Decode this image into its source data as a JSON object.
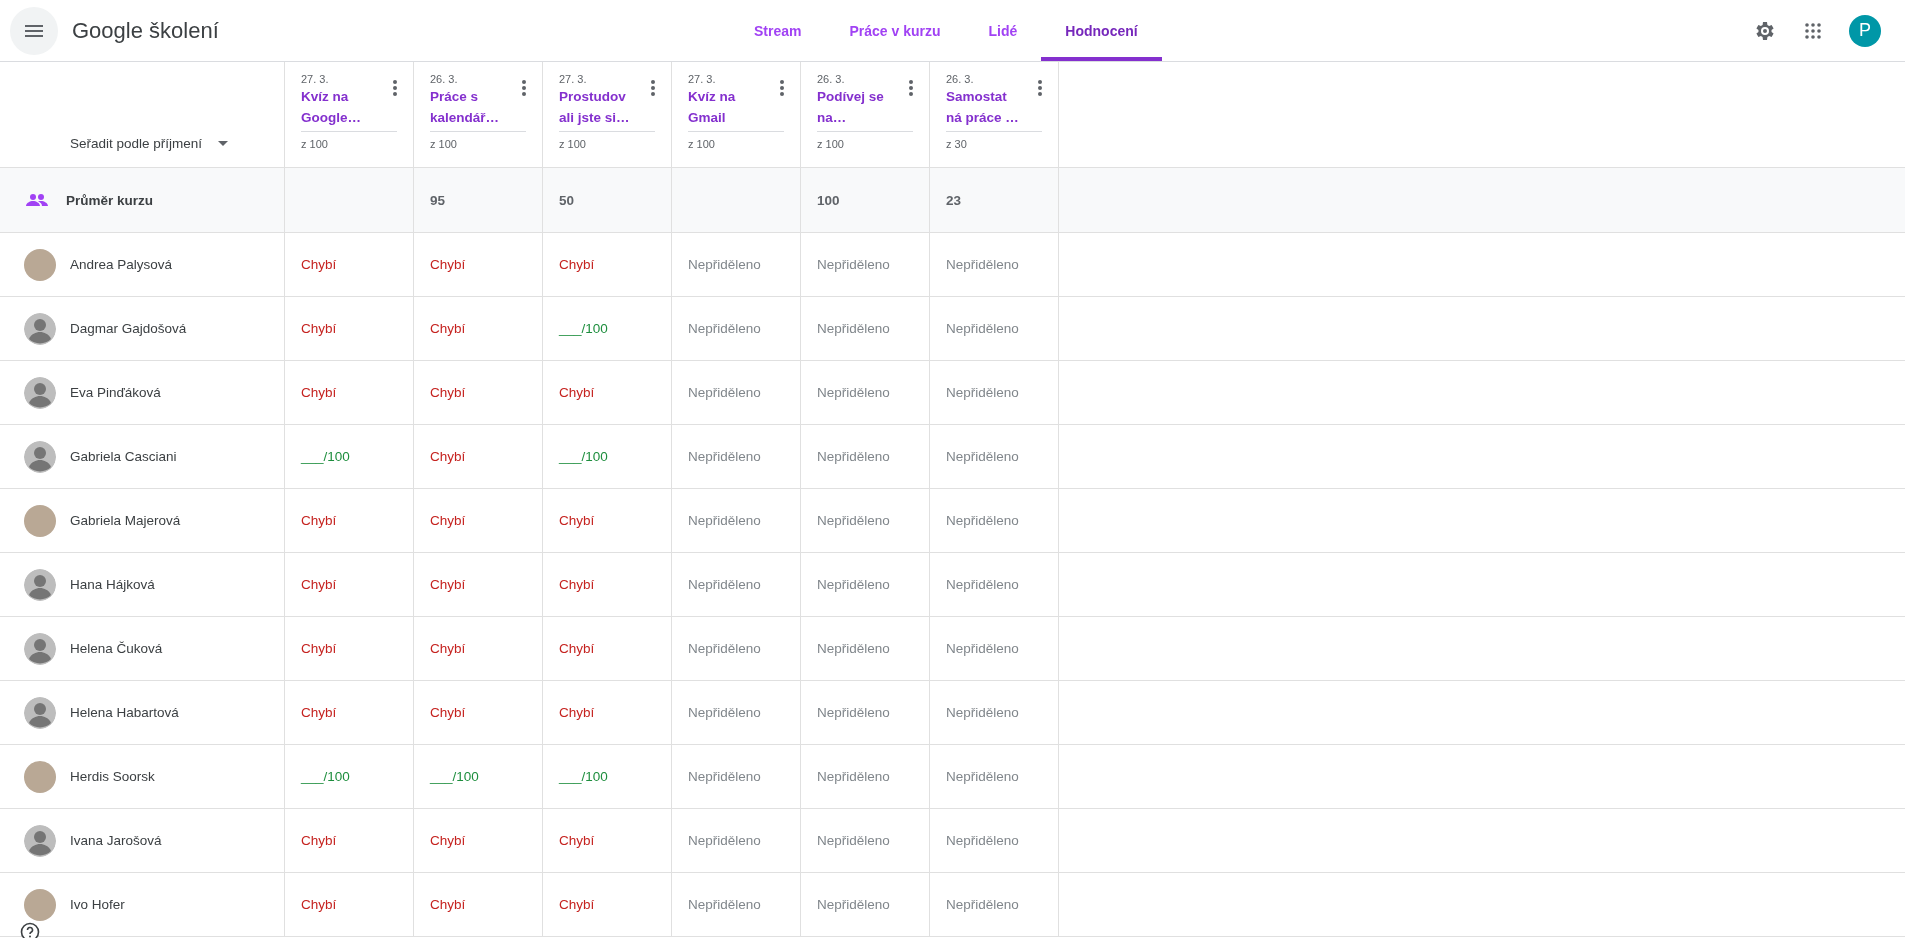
{
  "app_bar": {
    "title": "Google školení",
    "account_initial": "P",
    "tabs": [
      {
        "label": "Stream",
        "selected": false
      },
      {
        "label": "Práce v kurzu",
        "selected": false
      },
      {
        "label": "Lidé",
        "selected": false
      },
      {
        "label": "Hodnocení",
        "selected": true
      }
    ]
  },
  "gradebook": {
    "sort_label": "Seřadit podle příjmení",
    "assignments": [
      {
        "date": "27. 3.",
        "title_lines": [
          "Kvíz na",
          "Google…"
        ],
        "points": "z 100"
      },
      {
        "date": "26. 3.",
        "title_lines": [
          "Práce s",
          "kalendář…"
        ],
        "points": "z 100"
      },
      {
        "date": "27. 3.",
        "title_lines": [
          "Prostudov",
          "ali jste si…"
        ],
        "points": "z 100"
      },
      {
        "date": "27. 3.",
        "title_lines": [
          "Kvíz na",
          "Gmail"
        ],
        "points": "z 100"
      },
      {
        "date": "26. 3.",
        "title_lines": [
          "Podívej se",
          "na…"
        ],
        "points": "z 100"
      },
      {
        "date": "26. 3.",
        "title_lines": [
          "Samostat",
          "ná práce …"
        ],
        "points": "z 30"
      }
    ],
    "average": {
      "label": "Průměr kurzu",
      "values": [
        {
          "kind": "empty"
        },
        {
          "kind": "score",
          "text": "95"
        },
        {
          "kind": "score",
          "text": "50"
        },
        {
          "kind": "empty"
        },
        {
          "kind": "score",
          "text": "100"
        },
        {
          "kind": "score",
          "text": "23"
        }
      ]
    },
    "students": [
      {
        "name": "Andrea Palysová",
        "kind": "photo",
        "grades": [
          {
            "kind": "missing",
            "text": "Chybí"
          },
          {
            "kind": "missing",
            "text": "Chybí"
          },
          {
            "kind": "missing",
            "text": "Chybí"
          },
          {
            "kind": "unassigned",
            "text": "Nepřiděleno"
          },
          {
            "kind": "unassigned",
            "text": "Nepřiděleno"
          },
          {
            "kind": "unassigned",
            "text": "Nepřiděleno"
          }
        ]
      },
      {
        "name": "Dagmar Gajdošová",
        "kind": "default",
        "grades": [
          {
            "kind": "missing",
            "text": "Chybí"
          },
          {
            "kind": "missing",
            "text": "Chybí"
          },
          {
            "kind": "draft",
            "text": "___/100"
          },
          {
            "kind": "unassigned",
            "text": "Nepřiděleno"
          },
          {
            "kind": "unassigned",
            "text": "Nepřiděleno"
          },
          {
            "kind": "unassigned",
            "text": "Nepřiděleno"
          }
        ]
      },
      {
        "name": "Eva Pinďáková",
        "kind": "default",
        "grades": [
          {
            "kind": "missing",
            "text": "Chybí"
          },
          {
            "kind": "missing",
            "text": "Chybí"
          },
          {
            "kind": "missing",
            "text": "Chybí"
          },
          {
            "kind": "unassigned",
            "text": "Nepřiděleno"
          },
          {
            "kind": "unassigned",
            "text": "Nepřiděleno"
          },
          {
            "kind": "unassigned",
            "text": "Nepřiděleno"
          }
        ]
      },
      {
        "name": "Gabriela Casciani",
        "kind": "default",
        "grades": [
          {
            "kind": "draft",
            "text": "___/100"
          },
          {
            "kind": "missing",
            "text": "Chybí"
          },
          {
            "kind": "draft",
            "text": "___/100"
          },
          {
            "kind": "unassigned",
            "text": "Nepřiděleno"
          },
          {
            "kind": "unassigned",
            "text": "Nepřiděleno"
          },
          {
            "kind": "unassigned",
            "text": "Nepřiděleno"
          }
        ]
      },
      {
        "name": "Gabriela Majerová",
        "kind": "photo",
        "grades": [
          {
            "kind": "missing",
            "text": "Chybí"
          },
          {
            "kind": "missing",
            "text": "Chybí"
          },
          {
            "kind": "missing",
            "text": "Chybí"
          },
          {
            "kind": "unassigned",
            "text": "Nepřiděleno"
          },
          {
            "kind": "unassigned",
            "text": "Nepřiděleno"
          },
          {
            "kind": "unassigned",
            "text": "Nepřiděleno"
          }
        ]
      },
      {
        "name": "Hana Hájková",
        "kind": "default",
        "grades": [
          {
            "kind": "missing",
            "text": "Chybí"
          },
          {
            "kind": "missing",
            "text": "Chybí"
          },
          {
            "kind": "missing",
            "text": "Chybí"
          },
          {
            "kind": "unassigned",
            "text": "Nepřiděleno"
          },
          {
            "kind": "unassigned",
            "text": "Nepřiděleno"
          },
          {
            "kind": "unassigned",
            "text": "Nepřiděleno"
          }
        ]
      },
      {
        "name": "Helena Čuková",
        "kind": "default",
        "grades": [
          {
            "kind": "missing",
            "text": "Chybí"
          },
          {
            "kind": "missing",
            "text": "Chybí"
          },
          {
            "kind": "missing",
            "text": "Chybí"
          },
          {
            "kind": "unassigned",
            "text": "Nepřiděleno"
          },
          {
            "kind": "unassigned",
            "text": "Nepřiděleno"
          },
          {
            "kind": "unassigned",
            "text": "Nepřiděleno"
          }
        ]
      },
      {
        "name": "Helena Habartová",
        "kind": "default",
        "grades": [
          {
            "kind": "missing",
            "text": "Chybí"
          },
          {
            "kind": "missing",
            "text": "Chybí"
          },
          {
            "kind": "missing",
            "text": "Chybí"
          },
          {
            "kind": "unassigned",
            "text": "Nepřiděleno"
          },
          {
            "kind": "unassigned",
            "text": "Nepřiděleno"
          },
          {
            "kind": "unassigned",
            "text": "Nepřiděleno"
          }
        ]
      },
      {
        "name": "Herdis Soorsk",
        "kind": "photo",
        "grades": [
          {
            "kind": "draft",
            "text": "___/100"
          },
          {
            "kind": "draft",
            "text": "___/100"
          },
          {
            "kind": "draft",
            "text": "___/100"
          },
          {
            "kind": "unassigned",
            "text": "Nepřiděleno"
          },
          {
            "kind": "unassigned",
            "text": "Nepřiděleno"
          },
          {
            "kind": "unassigned",
            "text": "Nepřiděleno"
          }
        ]
      },
      {
        "name": "Ivana Jarošová",
        "kind": "default",
        "grades": [
          {
            "kind": "missing",
            "text": "Chybí"
          },
          {
            "kind": "missing",
            "text": "Chybí"
          },
          {
            "kind": "missing",
            "text": "Chybí"
          },
          {
            "kind": "unassigned",
            "text": "Nepřiděleno"
          },
          {
            "kind": "unassigned",
            "text": "Nepřiděleno"
          },
          {
            "kind": "unassigned",
            "text": "Nepřiděleno"
          }
        ]
      },
      {
        "name": "Ivo Hofer",
        "kind": "photo",
        "grades": [
          {
            "kind": "missing",
            "text": "Chybí"
          },
          {
            "kind": "missing",
            "text": "Chybí"
          },
          {
            "kind": "missing",
            "text": "Chybí"
          },
          {
            "kind": "unassigned",
            "text": "Nepřiděleno"
          },
          {
            "kind": "unassigned",
            "text": "Nepřiděleno"
          },
          {
            "kind": "unassigned",
            "text": "Nepřiděleno"
          }
        ]
      }
    ]
  }
}
